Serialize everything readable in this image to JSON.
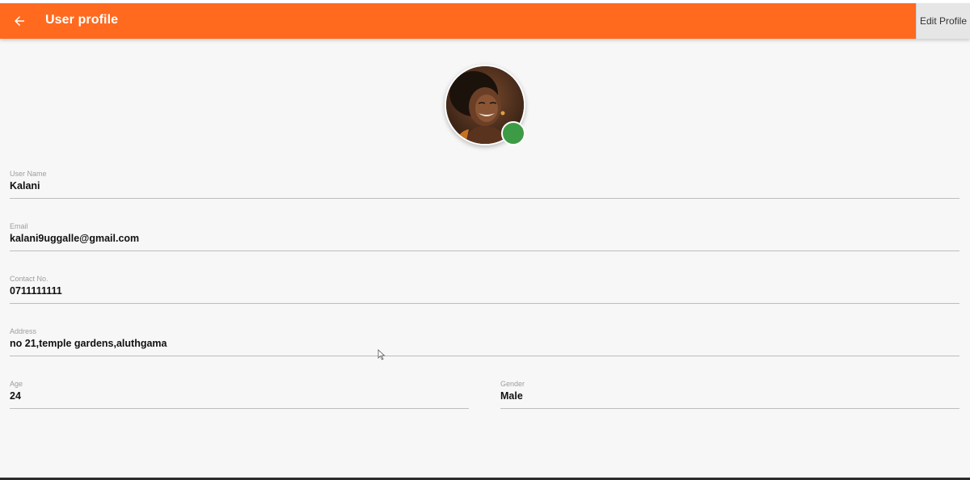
{
  "appbar": {
    "title": "User profile",
    "edit_label": "Edit Profile",
    "color": "#ff6a1f"
  },
  "profile": {
    "avatar_icon": "profile-photo",
    "status_color": "#3d9a45",
    "fields": {
      "user_name": {
        "label": "User Name",
        "value": "Kalani"
      },
      "email": {
        "label": "Email",
        "value": "kalani9uggalle@gmail.com"
      },
      "contact": {
        "label": "Contact No.",
        "value": "0711111111"
      },
      "address": {
        "label": "Address",
        "value": "no 21,temple gardens,aluthgama"
      },
      "age": {
        "label": "Age",
        "value": "24"
      },
      "gender": {
        "label": "Gender",
        "value": "Male"
      }
    }
  }
}
